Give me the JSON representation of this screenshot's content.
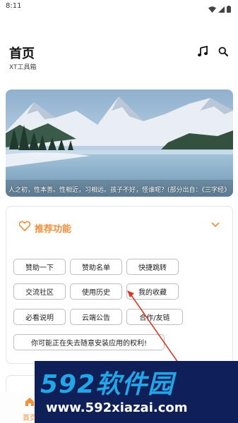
{
  "status_bar": {
    "time": "8:11"
  },
  "header": {
    "title": "首页",
    "subtitle": "XT工具箱"
  },
  "banner": {
    "caption": "人之初，性本善。性相近，习相远。孩子不好，怪谁呢？(部分出自：《三字经》"
  },
  "recommend": {
    "title": "推荐功能",
    "accent_color": "#f0903a",
    "chips": [
      "赞助一下",
      "赞助名单",
      "快捷跳转",
      "交流社区",
      "使用历史",
      "我的收藏",
      "必看说明",
      "云端公告",
      "合作/友链",
      "你可能正在失去随意安装应用的权利!"
    ]
  },
  "bottom_nav": {
    "home_label": "首页"
  },
  "watermark": {
    "brand": "592软件园",
    "url": "www.592xiazai.com"
  },
  "icons": [
    "wifi-icon",
    "signal-icon",
    "battery-icon",
    "music-note-icon",
    "search-icon",
    "heart-icon",
    "chevron-down-icon",
    "home-icon"
  ]
}
